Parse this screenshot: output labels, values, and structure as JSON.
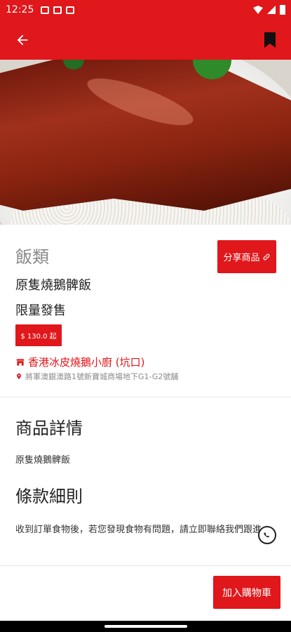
{
  "status_bar": {
    "time": "12:25",
    "icons": [
      "message-icon",
      "image-icon",
      "gmail-icon",
      "wifi-icon",
      "signal-icon",
      "battery-icon"
    ]
  },
  "app_bar": {
    "back_icon": "arrow-left-icon",
    "bookmark_icon": "bookmark-icon",
    "color": "#e0171b"
  },
  "hero": {
    "image": "roast goose rice photo",
    "pager_dots": 1
  },
  "product": {
    "category": "飯類",
    "name": "原隻燒鵝髀飯",
    "limited_label": "限量發售",
    "price": "$ 130.0 起",
    "share_label": "分享商品",
    "store_name": "香港冰皮燒鵝小廚 (坑口)",
    "store_address": "將軍澳銀澳路1號新寶城商場地下G1-G2號舖"
  },
  "details": {
    "title": "商品詳情",
    "text": "原隻燒鵝髀飯"
  },
  "terms": {
    "title": "條款細則",
    "text": "收到訂單食物後，若您發現食物有問題，請立即聯絡我們跟進。"
  },
  "actions": {
    "add_to_cart": "加入購物車",
    "whatsapp_icon": "whatsapp-icon"
  },
  "colors": {
    "accent": "#e0171b",
    "muted": "#8a8a8a"
  }
}
